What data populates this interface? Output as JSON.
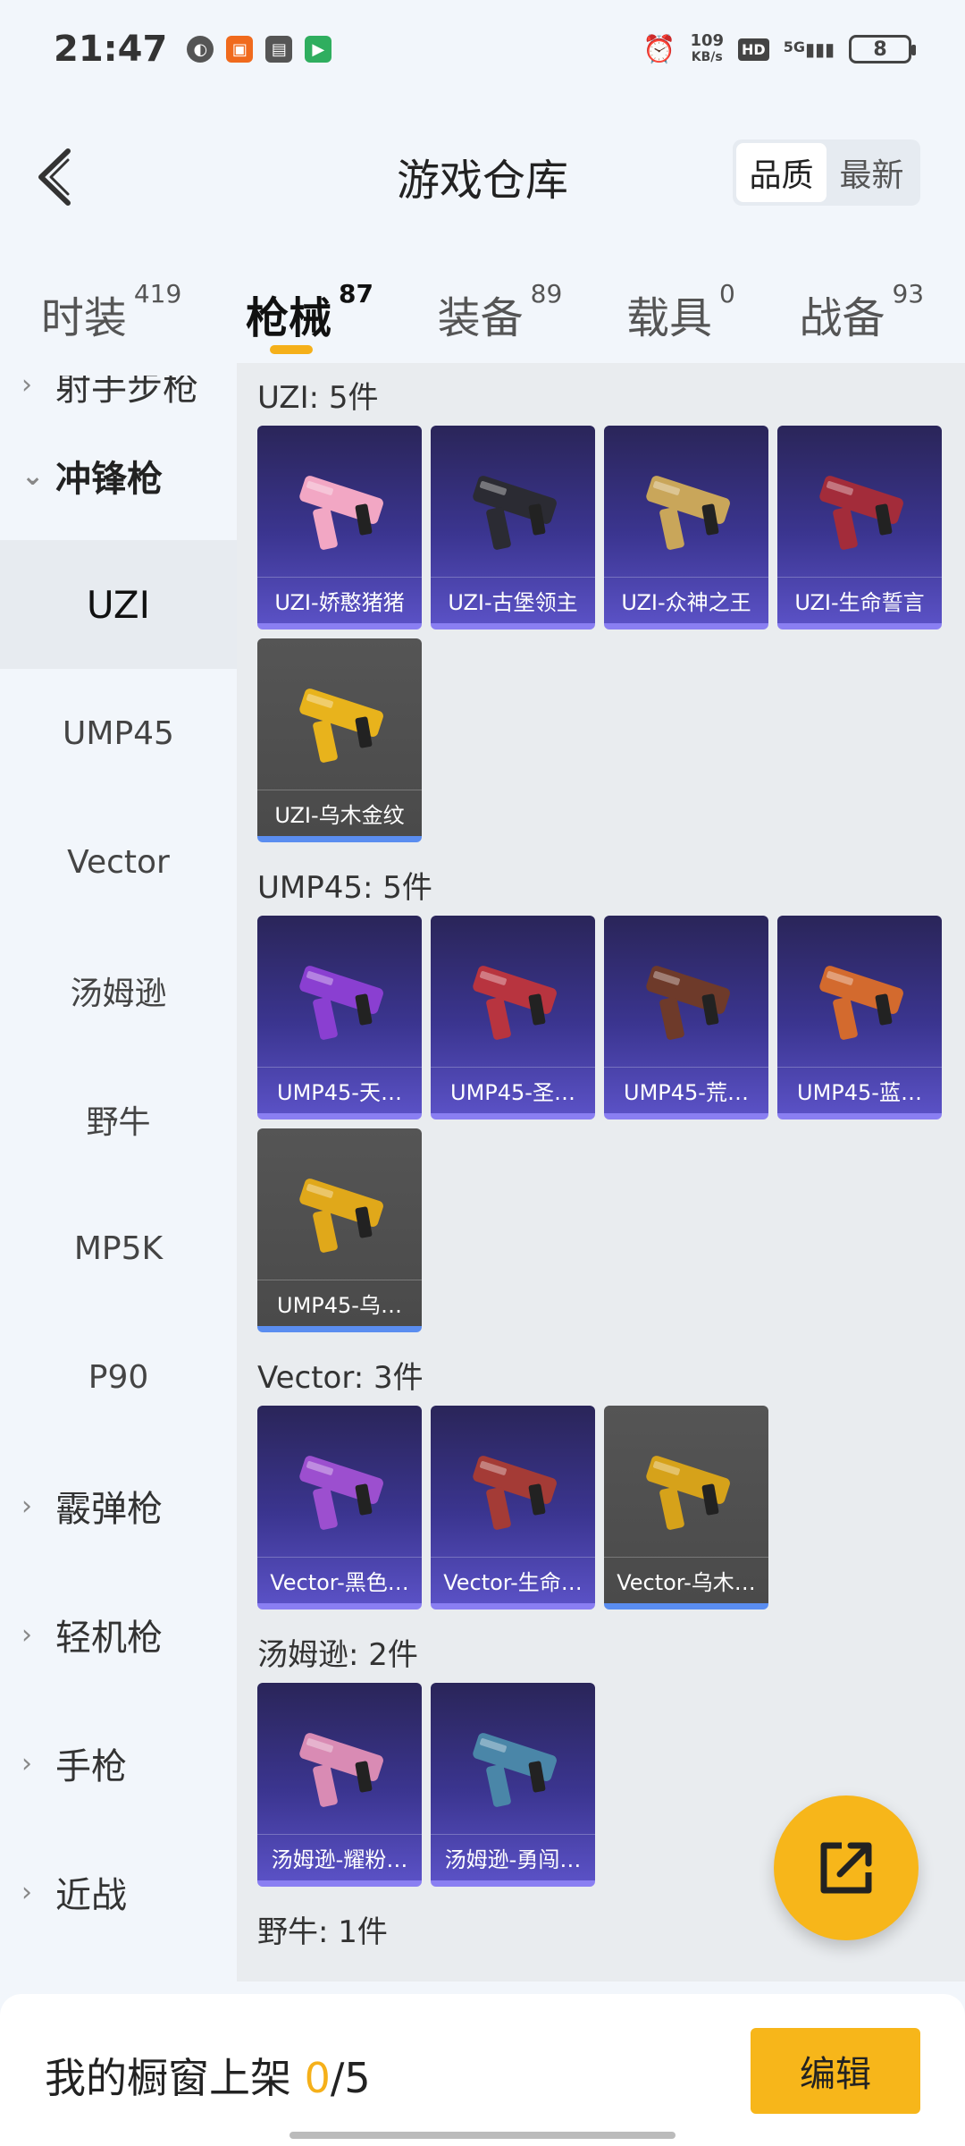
{
  "status_bar": {
    "time": "21:47",
    "speed_value": "109",
    "speed_unit": "KB/s",
    "hd": "HD",
    "network": "5G",
    "battery": "8"
  },
  "header": {
    "title": "游戏仓库",
    "sort_options": [
      "品质",
      "最新"
    ],
    "sort_active": "品质"
  },
  "tabs": [
    {
      "label": "时装",
      "count": "419"
    },
    {
      "label": "枪械",
      "count": "87",
      "active": true
    },
    {
      "label": "装备",
      "count": "89"
    },
    {
      "label": "载具",
      "count": "0"
    },
    {
      "label": "战备",
      "count": "93"
    }
  ],
  "sidebar": {
    "groups_top": [
      {
        "label": "射手步枪"
      },
      {
        "label": "冲锋枪",
        "open": true
      }
    ],
    "sub_items": [
      "UZI",
      "UMP45",
      "Vector",
      "汤姆逊",
      "野牛",
      "MP5K",
      "P90"
    ],
    "sub_active": "UZI",
    "groups_bottom": [
      "霰弹枪",
      "轻机枪",
      "手枪",
      "近战"
    ]
  },
  "sections": [
    {
      "title": "UZI: 5件",
      "items": [
        {
          "name": "UZI-娇憨猪猪",
          "style": "purple",
          "gun_color": "#f2a7c4"
        },
        {
          "name": "UZI-古堡领主",
          "style": "purple",
          "gun_color": "#2b2b33"
        },
        {
          "name": "UZI-众神之王",
          "style": "purple",
          "gun_color": "#c9a65a"
        },
        {
          "name": "UZI-生命誓言",
          "style": "purple",
          "gun_color": "#a32c3a"
        },
        {
          "name": "UZI-乌木金纹",
          "style": "grey",
          "gun_color": "#e8b31c"
        }
      ]
    },
    {
      "title": "UMP45: 5件",
      "items": [
        {
          "name": "UMP45-天…",
          "style": "purple",
          "gun_color": "#8a3fd1"
        },
        {
          "name": "UMP45-圣…",
          "style": "purple",
          "gun_color": "#b8343f"
        },
        {
          "name": "UMP45-荒…",
          "style": "purple",
          "gun_color": "#6e3a2a"
        },
        {
          "name": "UMP45-蓝…",
          "style": "purple",
          "gun_color": "#d36a2e"
        },
        {
          "name": "UMP45-乌…",
          "style": "grey",
          "gun_color": "#e0a81a"
        }
      ]
    },
    {
      "title": "Vector: 3件",
      "items": [
        {
          "name": "Vector-黑色…",
          "style": "purple",
          "gun_color": "#9c4fcf"
        },
        {
          "name": "Vector-生命…",
          "style": "purple",
          "gun_color": "#a43b36"
        },
        {
          "name": "Vector-乌木…",
          "style": "grey",
          "gun_color": "#d6a21a"
        }
      ]
    },
    {
      "title": "汤姆逊: 2件",
      "items": [
        {
          "name": "汤姆逊-耀粉…",
          "style": "purple",
          "gun_color": "#d98bb4"
        },
        {
          "name": "汤姆逊-勇闯…",
          "style": "purple",
          "gun_color": "#4a86a8"
        }
      ]
    },
    {
      "title": "野牛: 1件",
      "items": []
    }
  ],
  "bottom_bar": {
    "label": "我的橱窗上架 ",
    "used": "0",
    "total": "/5",
    "edit_label": "编辑"
  },
  "icons": {
    "back": "back-arrow-icon",
    "share": "share-export-icon"
  }
}
